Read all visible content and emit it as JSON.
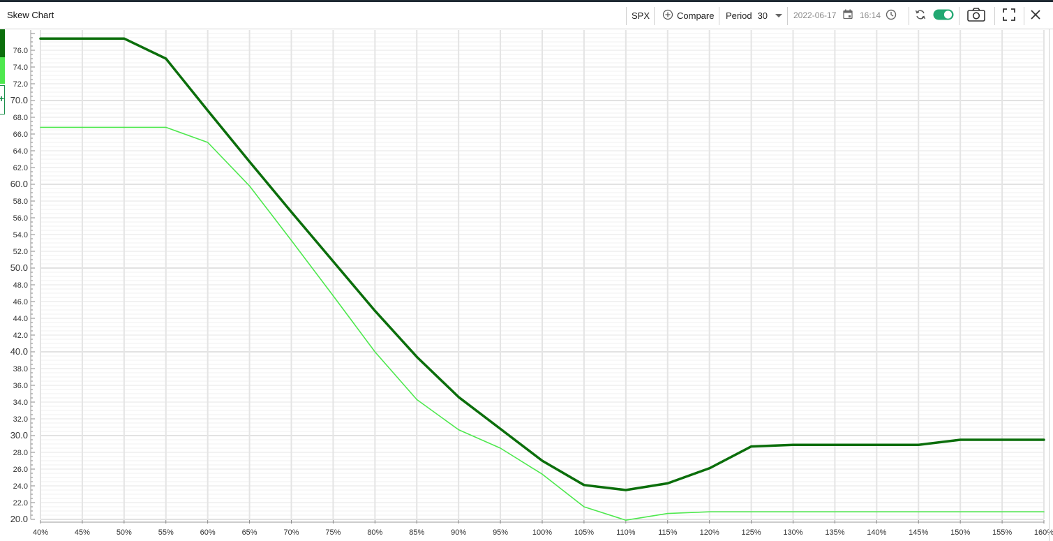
{
  "window": {
    "title": "Skew Chart"
  },
  "toolbar": {
    "symbol": "SPX",
    "compare_label": "Compare",
    "period_label": "Period",
    "period_value": "30",
    "date": "2022-06-17",
    "time": "16:14",
    "toggle_on": true
  },
  "legend_swatches": [
    {
      "color": "#0b6e0b"
    },
    {
      "color": "#4ee84e"
    }
  ],
  "chart_data": {
    "type": "line",
    "x": [
      40,
      45,
      50,
      55,
      60,
      65,
      70,
      75,
      80,
      85,
      90,
      95,
      100,
      105,
      110,
      115,
      120,
      125,
      130,
      135,
      140,
      145,
      150,
      155,
      160
    ],
    "x_tick_labels": [
      "40%",
      "45%",
      "50%",
      "55%",
      "60%",
      "65%",
      "70%",
      "75%",
      "80%",
      "85%",
      "90%",
      "95%",
      "100%",
      "105%",
      "110%",
      "115%",
      "120%",
      "125%",
      "130%",
      "135%",
      "140%",
      "145%",
      "150%",
      "155%",
      "160%"
    ],
    "xlim": [
      40,
      160
    ],
    "ylim": [
      20,
      78
    ],
    "y_ticks": [
      20,
      22,
      24,
      26,
      28,
      30,
      32,
      34,
      36,
      38,
      40,
      42,
      44,
      46,
      48,
      50,
      52,
      54,
      56,
      58,
      60,
      62,
      64,
      66,
      68,
      70,
      72,
      74,
      76
    ],
    "y_major_ticks": [
      20,
      30,
      40,
      50,
      60,
      70
    ],
    "grid": true,
    "series": [
      {
        "color": "#0b6e0b",
        "x": [
          40,
          45,
          50,
          55,
          60,
          65,
          70,
          75,
          80,
          85,
          90,
          95,
          100,
          105,
          110,
          115,
          120,
          125,
          130,
          135,
          140,
          145,
          150,
          155,
          160
        ],
        "values": [
          77.4,
          77.4,
          77.4,
          75.0,
          68.8,
          62.7,
          56.7,
          50.8,
          44.9,
          39.4,
          34.6,
          30.8,
          27.0,
          24.1,
          23.5,
          24.3,
          26.1,
          28.7,
          28.9,
          28.9,
          28.9,
          28.9,
          29.5,
          29.5,
          29.5
        ]
      },
      {
        "color": "#4ee84e",
        "x": [
          40,
          45,
          50,
          55,
          60,
          65,
          70,
          75,
          80,
          85,
          90,
          95,
          100,
          105,
          110,
          115,
          120,
          125,
          130,
          135,
          140,
          145,
          150,
          155,
          160
        ],
        "values": [
          66.8,
          66.8,
          66.8,
          66.8,
          65.0,
          59.8,
          53.3,
          46.7,
          40.0,
          34.3,
          30.7,
          28.5,
          25.4,
          21.5,
          19.9,
          20.7,
          20.9,
          20.9,
          20.9,
          20.9,
          20.9,
          20.9,
          20.9,
          20.9,
          20.9
        ]
      }
    ]
  }
}
